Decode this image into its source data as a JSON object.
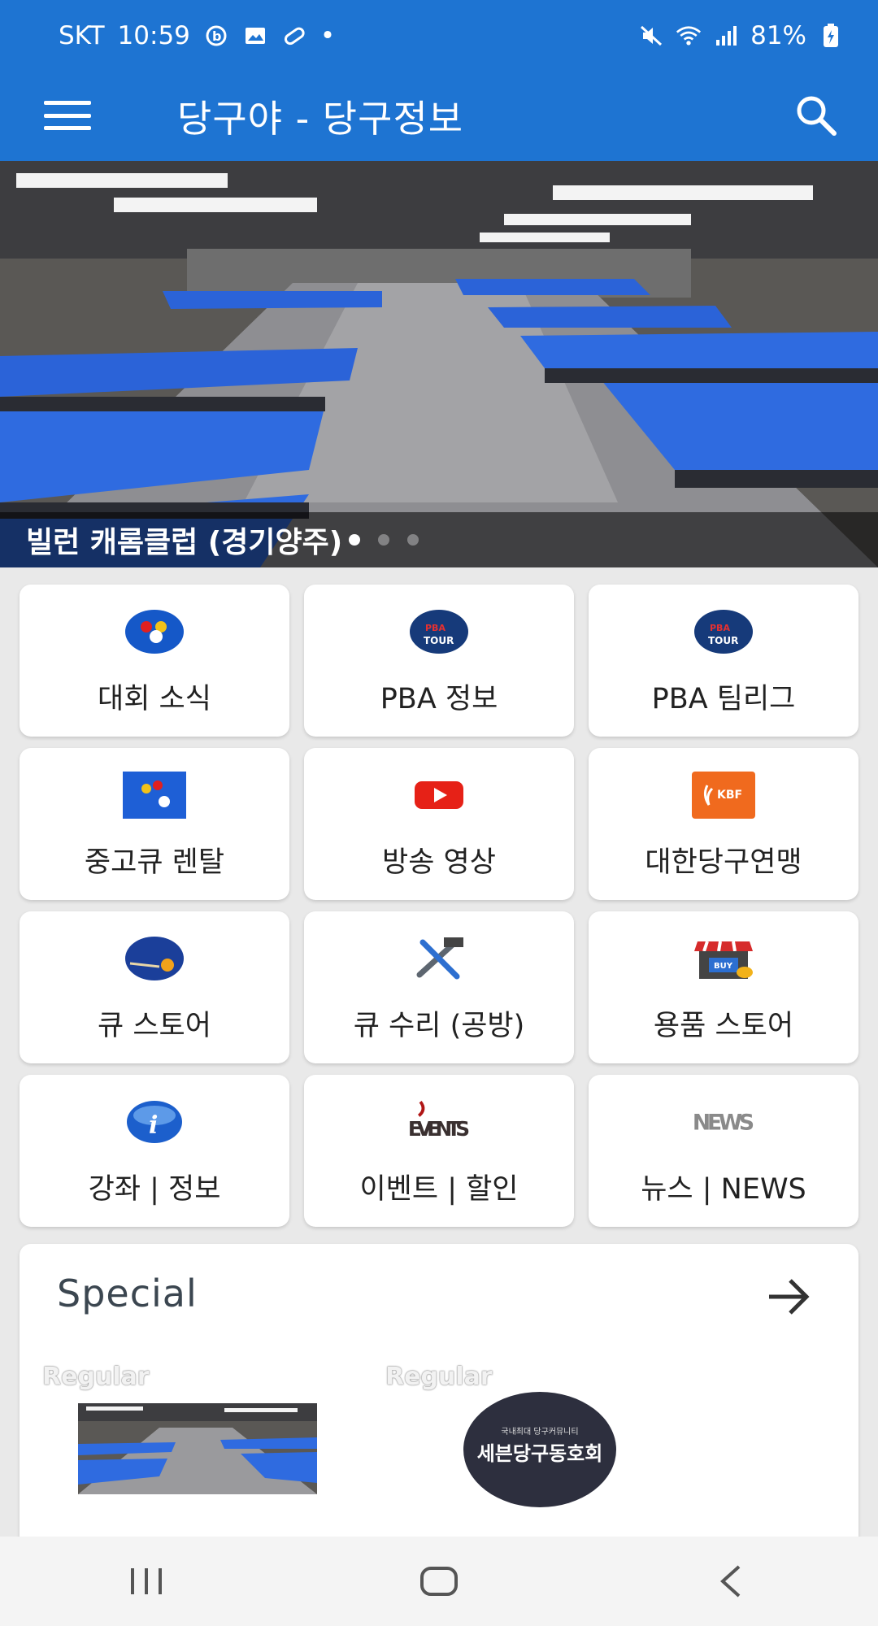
{
  "status_bar": {
    "carrier": "SKT",
    "time": "10:59",
    "dot": "•",
    "battery": "81%"
  },
  "app_bar": {
    "title": "당구야 - 당구정보"
  },
  "banner": {
    "caption": "빌런 캐롬클럽 (경기양주)",
    "page_count": 3,
    "active_page": 1
  },
  "menu": {
    "tiles": [
      {
        "label": "대회 소식",
        "icon": "billiard-balls-icon"
      },
      {
        "label": "PBA 정보",
        "icon": "pba-tour-icon"
      },
      {
        "label": "PBA 팀리그",
        "icon": "pba-tour-icon"
      },
      {
        "label": "중고큐 렌탈",
        "icon": "billiard-table-icon"
      },
      {
        "label": "방송 영상",
        "icon": "youtube-icon"
      },
      {
        "label": "대한당구연맹",
        "icon": "kbf-logo-icon"
      },
      {
        "label": "큐 스토어",
        "icon": "cue-ball-icon"
      },
      {
        "label": "큐 수리 (공방)",
        "icon": "tools-icon"
      },
      {
        "label": "용품 스토어",
        "icon": "shop-buy-icon"
      },
      {
        "label": "강좌 | 정보",
        "icon": "info-icon"
      },
      {
        "label": "이벤트 | 할인",
        "icon": "events-icon"
      },
      {
        "label": "뉴스 | NEWS",
        "icon": "news-icon"
      }
    ]
  },
  "special": {
    "title": "Special",
    "items": [
      {
        "tag": "Regular"
      },
      {
        "tag": "Regular",
        "logo_text_small": "국내최대 당구커뮤니티",
        "logo_text": "세븐당구동호회"
      }
    ]
  },
  "colors": {
    "primary": "#1e74d2",
    "table_blue": "#2f6be0",
    "youtube_red": "#e62117",
    "kbf_orange": "#f06a1e"
  }
}
